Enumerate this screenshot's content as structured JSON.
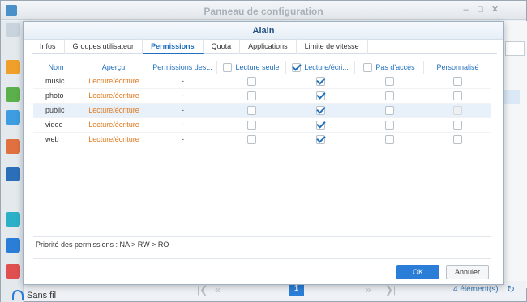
{
  "window": {
    "title": "Panneau de configuration",
    "min_icon": "–",
    "max_icon": "□",
    "close_icon": "✕"
  },
  "background": {
    "sidebar_label": "Sans fil",
    "pager_first": "|❮",
    "pager_prev": "«",
    "pager_next": "»",
    "pager_last": "❯|",
    "page": "1",
    "count": "4 élément(s)",
    "refresh_icon": "↻"
  },
  "dialog": {
    "title": "Alain",
    "tabs": [
      "Infos",
      "Groupes utilisateur",
      "Permissions",
      "Quota",
      "Applications",
      "Limite de vitesse"
    ],
    "active_tab": "Permissions",
    "columns": {
      "nom": "Nom",
      "apercu": "Aperçu",
      "permissions": "Permissions des...",
      "lecture_seule": "Lecture seule",
      "lecture_ecriture": "Lecture/écri...",
      "pas_acces": "Pas d'accès",
      "personnalise": "Personnalisé"
    },
    "header_checks": {
      "lecture_seule": false,
      "lecture_ecriture": true,
      "pas_acces": false
    },
    "rows": [
      {
        "nom": "music",
        "apercu": "Lecture/écriture",
        "permissions": "-",
        "lecture_seule": false,
        "lecture_ecriture": true,
        "pas_acces": false,
        "personnalise": false
      },
      {
        "nom": "photo",
        "apercu": "Lecture/écriture",
        "permissions": "-",
        "lecture_seule": false,
        "lecture_ecriture": true,
        "pas_acces": false,
        "personnalise": false
      },
      {
        "nom": "public",
        "apercu": "Lecture/écriture",
        "permissions": "-",
        "lecture_seule": false,
        "lecture_ecriture": true,
        "pas_acces": false,
        "personnalise": false
      },
      {
        "nom": "video",
        "apercu": "Lecture/écriture",
        "permissions": "-",
        "lecture_seule": false,
        "lecture_ecriture": true,
        "pas_acces": false,
        "personnalise": false
      },
      {
        "nom": "web",
        "apercu": "Lecture/écriture",
        "permissions": "-",
        "lecture_seule": false,
        "lecture_ecriture": true,
        "pas_acces": false,
        "personnalise": false
      }
    ],
    "priority": "Priorité des permissions : NA > RW > RO",
    "ok_label": "OK",
    "cancel_label": "Annuler"
  },
  "colors": {
    "accent": "#1f6fbf",
    "ok_button": "#2b7ed8",
    "apercu_text": "#e07a1f",
    "selected_row": "#e8f1fa"
  }
}
